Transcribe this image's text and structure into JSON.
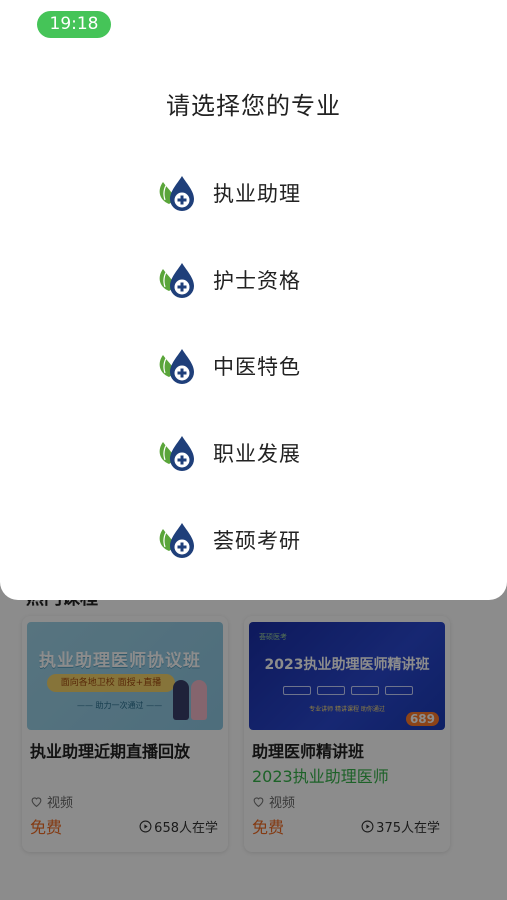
{
  "status_bar": {
    "time": "19:18"
  },
  "sheet": {
    "title": "请选择您的专业",
    "options": [
      {
        "label": "执业助理",
        "icon": "medical-drop-icon"
      },
      {
        "label": "护士资格",
        "icon": "medical-drop-icon"
      },
      {
        "label": "中医特色",
        "icon": "medical-drop-icon"
      },
      {
        "label": "职业发展",
        "icon": "medical-drop-icon"
      },
      {
        "label": "荟硕考研",
        "icon": "medical-drop-icon"
      }
    ]
  },
  "background": {
    "section_title": "热门课程",
    "courses": [
      {
        "thumb_title": "执业助理医师协议班",
        "thumb_pill": "面向各地卫校  面授+直播",
        "thumb_sub": "—— 助力一次通过 ——",
        "title": "执业助理近期直播回放",
        "subtitle": "",
        "type": "视频",
        "price": "免费",
        "learners": "658人在学"
      },
      {
        "thumb_logo": "荟硕医考",
        "thumb_title": "2023执业助理医师精讲班",
        "thumb_line": "专业讲师  精讲课程  助你通过",
        "thumb_badge": "689",
        "title": "助理医师精讲班",
        "subtitle": "2023执业助理医师",
        "type": "视频",
        "price": "免费",
        "learners": "375人在学"
      }
    ]
  },
  "colors": {
    "accent_green": "#45c458",
    "price_orange": "#f06a22",
    "icon_navy": "#1f3f7a",
    "leaf_green": "#5aa53a"
  }
}
